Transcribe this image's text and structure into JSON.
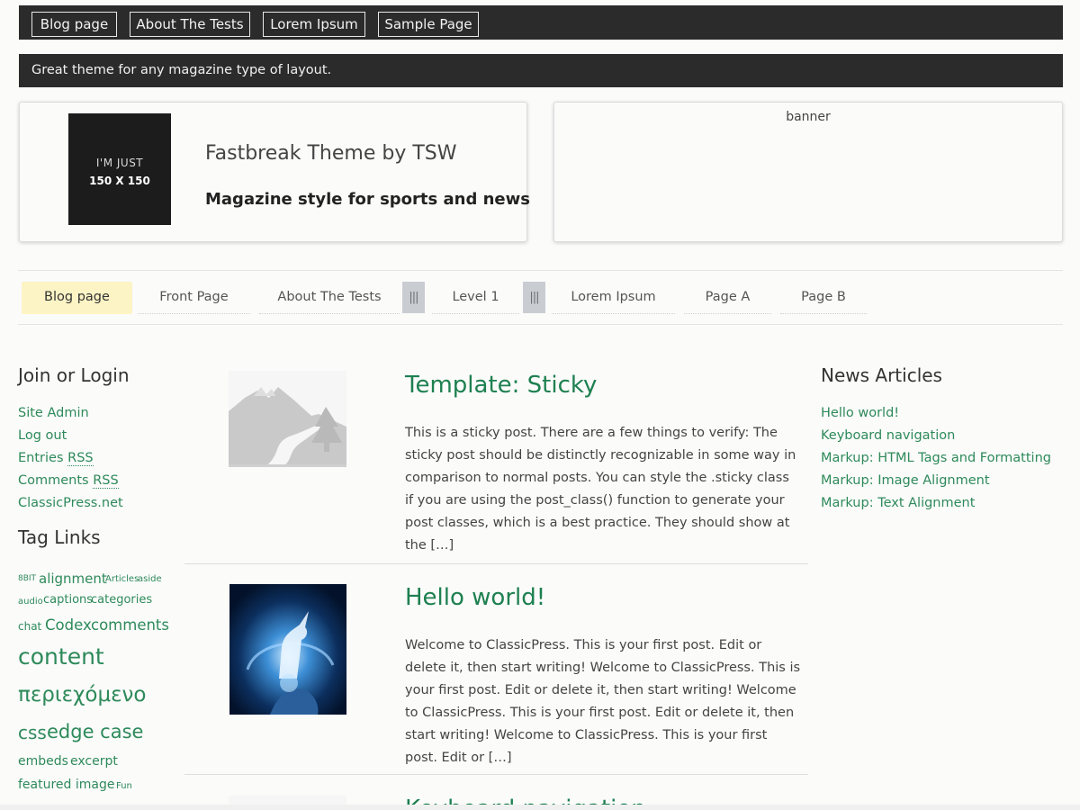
{
  "top_menu": [
    "Blog page",
    "About The Tests",
    "Lorem Ipsum",
    "Sample Page"
  ],
  "tagline": "Great theme for any magazine type of layout.",
  "logo": {
    "line1": "I'M JUST",
    "line2": "150 X 150"
  },
  "site_title": "Fastbreak Theme by TSW",
  "site_description": "Magazine style for sports and news",
  "banner": "banner",
  "main_nav": {
    "items": [
      "Blog page",
      "Front Page",
      "About The Tests",
      "Level 1",
      "Lorem Ipsum",
      "Page A",
      "Page B"
    ],
    "submenu_toggle": "|||",
    "active": "Blog page"
  },
  "left_sidebar": {
    "join_title": "Join or Login",
    "links": [
      "Site Admin",
      "Log out",
      "Entries",
      "Comments",
      "ClassicPress.net"
    ],
    "rss": "RSS",
    "tags_title": "Tag Links",
    "tags": [
      "8BIT",
      "alignment",
      "Articles",
      "aside",
      "audio",
      "captions",
      "categories",
      "chat",
      "Codex",
      "comments",
      "content",
      "περιεχόμενο",
      "css",
      "edge case",
      "embeds",
      "excerpt",
      "featured image",
      "Fun"
    ]
  },
  "posts": [
    {
      "title": "Template: Sticky",
      "excerpt": "This is a sticky post. There are a few things to verify: The sticky post should be distinctly recognizable in some way in comparison to normal posts. You can style the .sticky class if you are using the post_class() function to generate your post classes, which is a best practice. They should show at the […]"
    },
    {
      "title": "Hello world!",
      "excerpt": "Welcome to ClassicPress. This is your first post. Edit or delete it, then start writing! Welcome to ClassicPress. This is your first post. Edit or delete it, then start writing! Welcome to ClassicPress. This is your first post. Edit or delete it, then start writing! Welcome to ClassicPress. This is your first post. Edit or […]"
    },
    {
      "title": "Keyboard navigation"
    }
  ],
  "right_sidebar": {
    "title": "News Articles",
    "links": [
      "Hello world!",
      "Keyboard navigation",
      "Markup: HTML Tags and Formatting",
      "Markup: Image Alignment",
      "Markup: Text Alignment"
    ]
  },
  "colors": {
    "link": "#2e8a5a",
    "post_title": "#1e8050",
    "bar": "#2b2b2b",
    "active_nav": "#fdf4c5"
  }
}
